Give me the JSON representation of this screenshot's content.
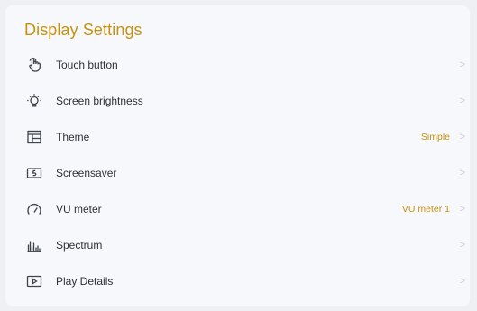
{
  "page": {
    "title": "Display Settings"
  },
  "settings": {
    "items": [
      {
        "label": "Touch button",
        "value": "",
        "icon": "touch-hand-icon"
      },
      {
        "label": "Screen brightness",
        "value": "",
        "icon": "lightbulb-icon"
      },
      {
        "label": "Theme",
        "value": "Simple",
        "icon": "theme-layout-icon"
      },
      {
        "label": "Screensaver",
        "value": "",
        "icon": "screensaver-icon"
      },
      {
        "label": "VU meter",
        "value": "VU meter 1",
        "icon": "gauge-icon"
      },
      {
        "label": "Spectrum",
        "value": "",
        "icon": "spectrum-bars-icon"
      },
      {
        "label": "Play Details",
        "value": "",
        "icon": "play-details-icon"
      }
    ],
    "chevron": ">"
  },
  "colors": {
    "accent": "#c8920f",
    "text": "#2e3238",
    "panel": "#f6f8fb",
    "background": "#eef0f3"
  }
}
